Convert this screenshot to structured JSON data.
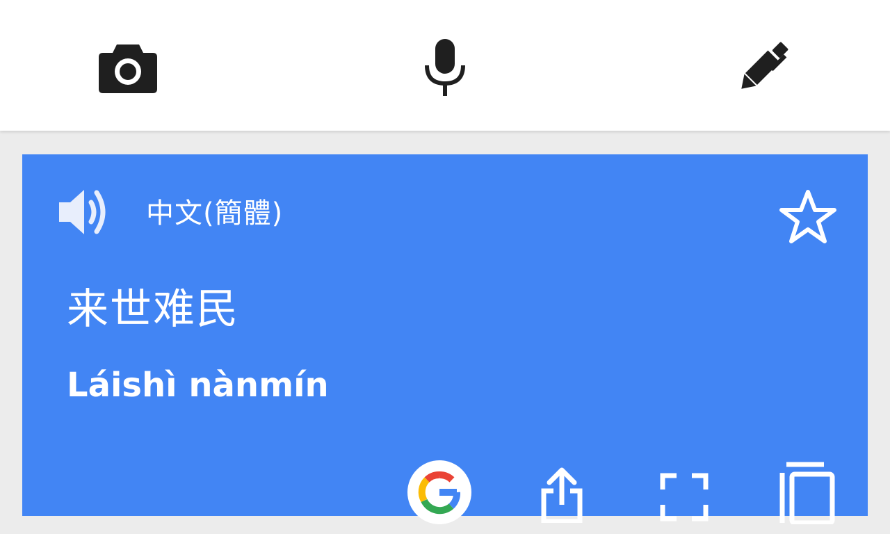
{
  "toolbar": {
    "camera_icon": "camera-icon",
    "mic_icon": "microphone-icon",
    "handwrite_icon": "pen-icon"
  },
  "result_card": {
    "background": "#4285f4",
    "language": "中文(簡體)",
    "translation": "来世难民",
    "romanization": "Láishì nànmín",
    "speak_icon": "speaker-icon",
    "star_icon": "star-outline-icon"
  },
  "actions": [
    {
      "icon": "google-icon"
    },
    {
      "icon": "share-icon"
    },
    {
      "icon": "fullscreen-icon"
    },
    {
      "icon": "copy-icon"
    }
  ]
}
